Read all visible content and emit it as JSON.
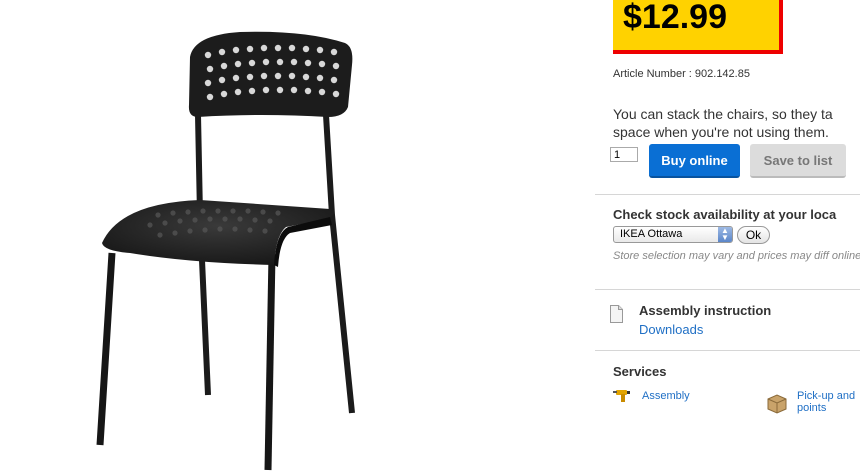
{
  "product": {
    "price": "$12.99",
    "article_number": "Article Number : 902.142.85",
    "description_line1": "You can stack the chairs, so they ta",
    "description_line2": "space when you're not using them."
  },
  "purchase": {
    "quantity_value": "1",
    "buy_label": "Buy online",
    "save_label": "Save to list"
  },
  "stock": {
    "heading": "Check stock availability at your loca",
    "store_selected": "IKEA Ottawa",
    "ok_label": "Ok",
    "note": "Store selection may vary and prices may diff online"
  },
  "assembly": {
    "heading": "Assembly instruction",
    "link": "Downloads",
    "icon": "document-icon"
  },
  "services": {
    "heading": "Services",
    "items": [
      {
        "label": "Assembly",
        "icon": "drill-icon"
      },
      {
        "label_line1": "Pick-up and",
        "label_line2": "points",
        "icon": "box-icon"
      }
    ]
  },
  "colors": {
    "price_bg": "#ffd200",
    "price_border": "#e00000",
    "buy_button": "#0a6fd4",
    "link": "#1f6fc5"
  }
}
